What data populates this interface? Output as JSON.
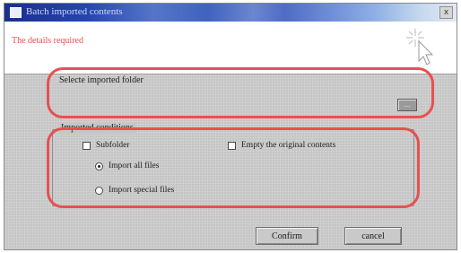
{
  "window": {
    "title": "Batch imported contents",
    "close_label": "x"
  },
  "header": {
    "title": "The details required"
  },
  "folder_section": {
    "label": "Selecte imported folder",
    "browse_label": "..."
  },
  "conditions": {
    "group_label": "Imported conditions",
    "options": {
      "subfolder": {
        "label": "Subfolder",
        "checked": false
      },
      "empty_original": {
        "label": "Empty the original contents",
        "checked": false
      },
      "import_all": {
        "label": "Import all files",
        "selected": true
      },
      "import_special": {
        "label": "Import special files",
        "selected": false
      }
    }
  },
  "buttons": {
    "confirm_label": "Confirm",
    "cancel_label": "cancel"
  },
  "colors": {
    "highlight": "#e85050",
    "header_title": "#e05050",
    "dialog_bg": "#c6c6c6"
  },
  "icons": {
    "title_icon": "window-icon",
    "header_icon": "sparkle-cursor-icon"
  }
}
